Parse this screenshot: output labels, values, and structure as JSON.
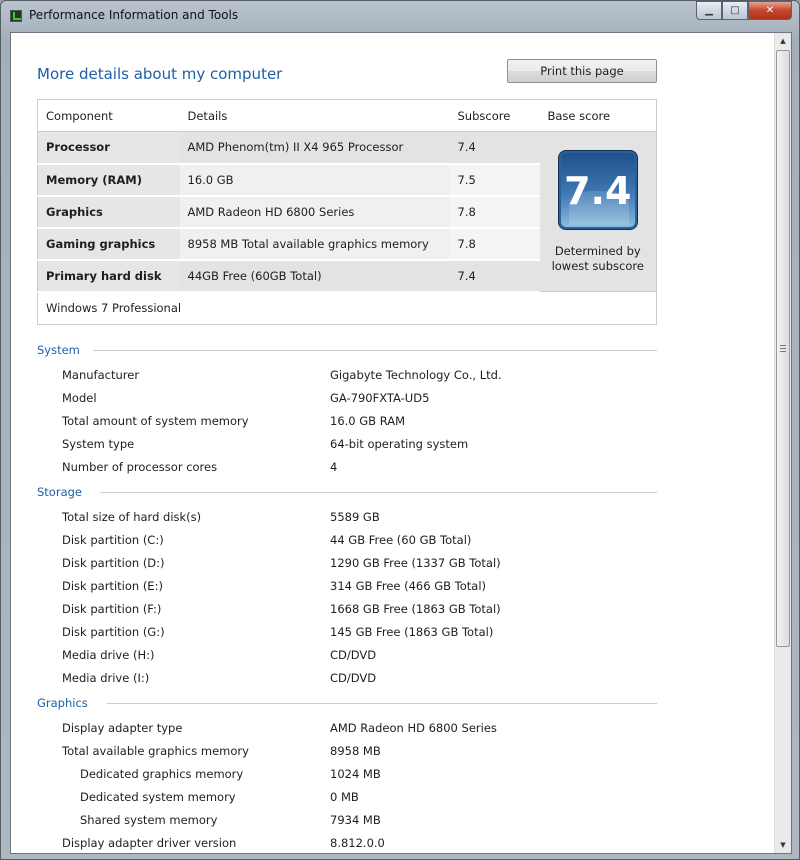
{
  "window": {
    "title": "Performance Information and Tools"
  },
  "heading": "More details about my computer",
  "print_button": "Print this page",
  "score_table": {
    "headers": [
      "Component",
      "Details",
      "Subscore",
      "Base score"
    ],
    "rows": [
      {
        "component": "Processor",
        "details": "AMD Phenom(tm) II X4 965 Processor",
        "subscore": "7.4"
      },
      {
        "component": "Memory (RAM)",
        "details": "16.0 GB",
        "subscore": "7.5"
      },
      {
        "component": "Graphics",
        "details": "AMD Radeon HD 6800 Series",
        "subscore": "7.8"
      },
      {
        "component": "Gaming graphics",
        "details": "8958 MB Total available graphics memory",
        "subscore": "7.8"
      },
      {
        "component": "Primary hard disk",
        "details": "44GB Free (60GB Total)",
        "subscore": "7.4"
      }
    ],
    "base_score": "7.4",
    "base_caption": "Determined by lowest subscore",
    "os": "Windows 7 Professional"
  },
  "sections": [
    {
      "title": "System",
      "items": [
        {
          "label": "Manufacturer",
          "value": "Gigabyte Technology Co., Ltd."
        },
        {
          "label": "Model",
          "value": "GA-790FXTA-UD5"
        },
        {
          "label": "Total amount of system memory",
          "value": "16.0 GB RAM"
        },
        {
          "label": "System type",
          "value": "64-bit operating system"
        },
        {
          "label": "Number of processor cores",
          "value": "4"
        }
      ]
    },
    {
      "title": "Storage",
      "items": [
        {
          "label": "Total size of hard disk(s)",
          "value": "5589 GB"
        },
        {
          "label": "Disk partition (C:)",
          "value": "44 GB Free (60 GB Total)"
        },
        {
          "label": "Disk partition (D:)",
          "value": "1290 GB Free (1337 GB Total)"
        },
        {
          "label": "Disk partition (E:)",
          "value": "314 GB Free (466 GB Total)"
        },
        {
          "label": "Disk partition (F:)",
          "value": "1668 GB Free (1863 GB Total)"
        },
        {
          "label": "Disk partition (G:)",
          "value": "145 GB Free (1863 GB Total)"
        },
        {
          "label": "Media drive (H:)",
          "value": "CD/DVD"
        },
        {
          "label": "Media drive (I:)",
          "value": "CD/DVD"
        }
      ]
    },
    {
      "title": "Graphics",
      "items": [
        {
          "label": "Display adapter type",
          "value": "AMD Radeon HD 6800 Series"
        },
        {
          "label": "Total available graphics memory",
          "value": "8958 MB"
        },
        {
          "label": "Dedicated graphics memory",
          "value": "1024 MB",
          "indent": true
        },
        {
          "label": "Dedicated system memory",
          "value": "0 MB",
          "indent": true
        },
        {
          "label": "Shared system memory",
          "value": "7934 MB",
          "indent": true
        },
        {
          "label": "Display adapter driver version",
          "value": "8.812.0.0"
        }
      ]
    }
  ]
}
